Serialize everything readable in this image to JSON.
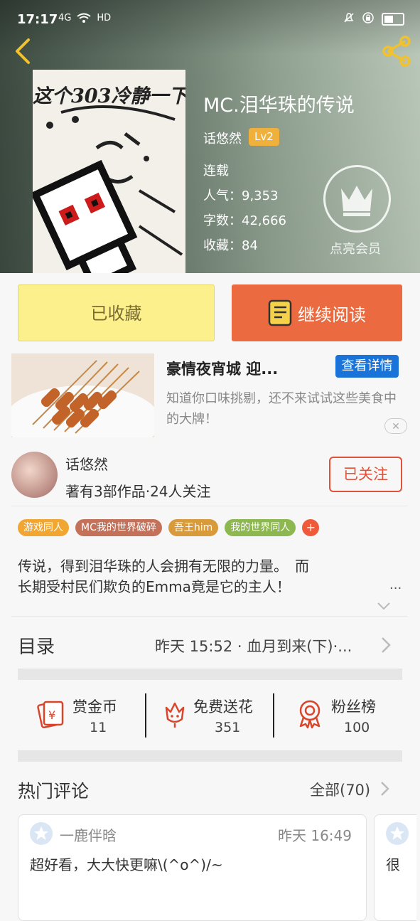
{
  "status_bar": {
    "time": "17:17",
    "network": "4G",
    "hd": "HD"
  },
  "book": {
    "title": "MC.泪华珠的传说",
    "author": "话悠然",
    "author_level": "Lv2",
    "status": "连载",
    "popularity_label": "人气：",
    "popularity": "9,353",
    "words_label": "字数：",
    "words": "42,666",
    "favorites_label": "收藏：",
    "favorites": "84",
    "cover_text": "这个303冷静一下"
  },
  "vip": {
    "label": "点亮会员"
  },
  "actions": {
    "favorited_label": "已收藏",
    "continue_label": "继续阅读"
  },
  "ad": {
    "title": "豪情夜宵城 迎...",
    "button": "查看详情",
    "description": "知道你口味挑剔，还不来试试这些美食中的大牌！"
  },
  "author_card": {
    "name": "话悠然",
    "works": "著有3部作品·24人关注",
    "follow_label": "已关注"
  },
  "tags": [
    {
      "label": "游戏同人",
      "color": "#f0a630"
    },
    {
      "label": "MC我的世界破碎",
      "color": "#c4715a"
    },
    {
      "label": "吾王him",
      "color": "#d89a3a"
    },
    {
      "label": "我的世界同人",
      "color": "#8cb84f"
    }
  ],
  "tag_more": "+",
  "synopsis": {
    "line1": "传说，得到泪华珠的人会拥有无限的力量。　而",
    "line2": "长期受村民们欺负的Emma竟是它的主人！",
    "more": "..."
  },
  "catalog": {
    "label": "目录",
    "latest": "昨天 15:52 · 血月到来(下)·..."
  },
  "gifts": [
    {
      "label": "赏金币",
      "count": "11"
    },
    {
      "label": "免费送花",
      "count": "351"
    },
    {
      "label": "粉丝榜",
      "count": "100"
    }
  ],
  "comments": {
    "title": "热门评论",
    "all_label": "全部(70)",
    "items": [
      {
        "user": "一鹿伴晗",
        "time": "昨天 16:49",
        "text": "超好看，大大快更嘛\\(^o^)/~"
      },
      {
        "user": "",
        "time": "",
        "text": "很"
      }
    ]
  },
  "colors": {
    "accent": "#ec6a3f",
    "favorite_bg": "#fbf08b",
    "follow": "#e0523a",
    "ad_button": "#1a73d9",
    "icon_red": "#d9452b"
  }
}
